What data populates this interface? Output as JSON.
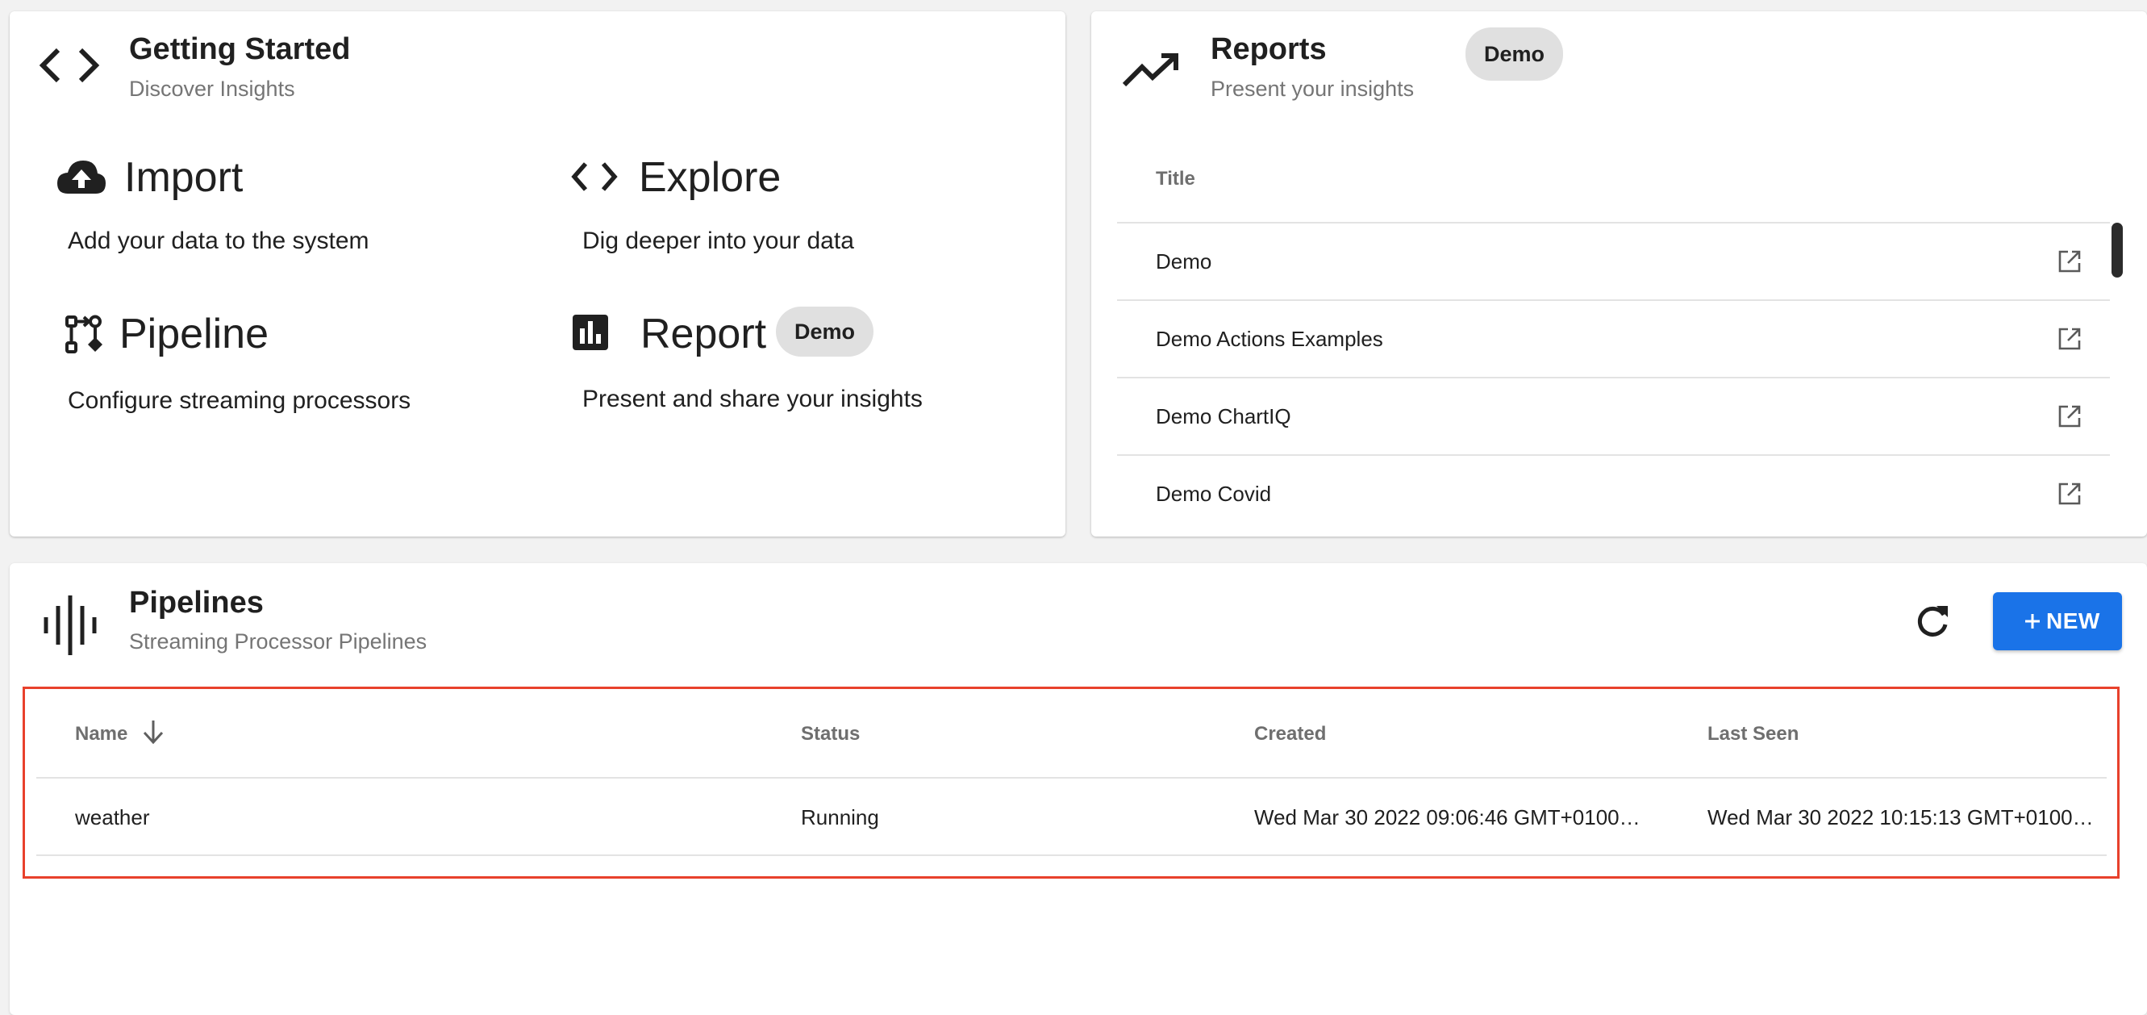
{
  "getting_started": {
    "title": "Getting Started",
    "subtitle": "Discover Insights",
    "icon": "code-icon",
    "actions": [
      {
        "title": "Import",
        "description": "Add your data to the system",
        "icon": "cloud-upload-icon"
      },
      {
        "title": "Explore",
        "description": "Dig deeper into your data",
        "icon": "code-icon"
      },
      {
        "title": "Pipeline",
        "description": "Configure streaming processors",
        "icon": "pipeline-icon"
      },
      {
        "title": "Report",
        "description": "Present and share your insights",
        "icon": "bar-chart-icon",
        "badge": "Demo"
      }
    ]
  },
  "reports": {
    "title": "Reports",
    "subtitle": "Present your insights",
    "badge": "Demo",
    "icon": "trending-up-icon",
    "column_title": "Title",
    "items": [
      "Demo",
      "Demo Actions Examples",
      "Demo ChartIQ",
      "Demo Covid"
    ],
    "row_icon": "open-in-new-icon"
  },
  "pipelines": {
    "title": "Pipelines",
    "subtitle": "Streaming Processor Pipelines",
    "icon": "waveform-icon",
    "new_label": "NEW",
    "new_icon": "plus-icon",
    "refresh_icon": "refresh-icon",
    "accent_color": "#1a73e8",
    "highlight_color": "#e8412c",
    "columns": {
      "name": "Name",
      "status": "Status",
      "created": "Created",
      "last_seen": "Last Seen"
    },
    "sort_icon": "arrow-down-icon",
    "rows": [
      {
        "name": "weather",
        "status": "Running",
        "created": "Wed Mar 30 2022 09:06:46 GMT+0100…",
        "last_seen": "Wed Mar 30 2022 10:15:13 GMT+0100…"
      }
    ]
  }
}
